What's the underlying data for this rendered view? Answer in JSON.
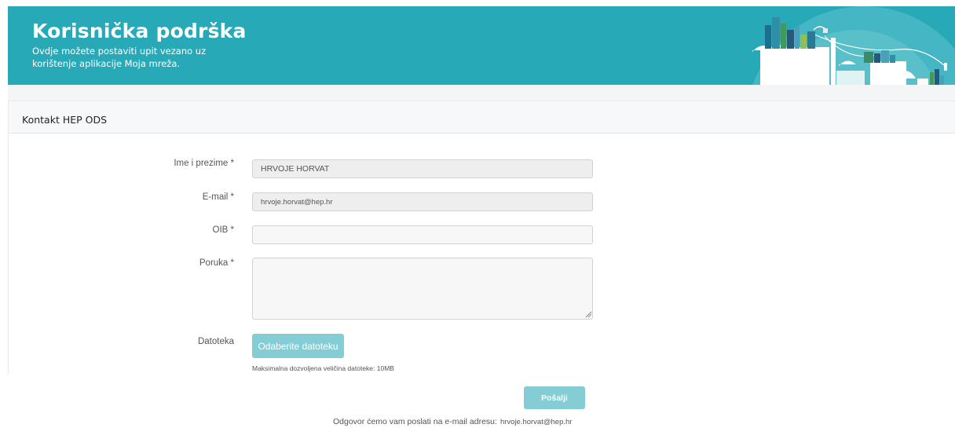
{
  "banner": {
    "title": "Korisnička podrška",
    "subtitle": "Ovdje možete postaviti upit vezano uz korištenje aplikacije Moja mreža."
  },
  "card": {
    "title": "Kontakt HEP ODS"
  },
  "form": {
    "name_label": "Ime i prezime *",
    "name_value": "HRVOJE HORVAT",
    "email_label": "E-mail *",
    "email_value": "hrvoje.horvat@hep.hr",
    "oib_label": "OIB *",
    "oib_value": "",
    "message_label": "Poruka *",
    "message_value": "",
    "file_label": "Datoteka",
    "file_button": "Odaberite datoteku",
    "file_hint": "Maksimalna dozvoljena veličina datoteke: 10MB",
    "submit_label": "Pošalji",
    "reply_text": "Odgovor ćemo vam poslati na e-mail adresu:",
    "reply_email": "hrvoje.horvat@hep.hr"
  },
  "colors": {
    "banner": "#28a9b8",
    "button": "#84cdd4"
  },
  "icons": {
    "illustration": "city-power-network-illustration",
    "resize": "textarea-resize-grip-icon"
  }
}
